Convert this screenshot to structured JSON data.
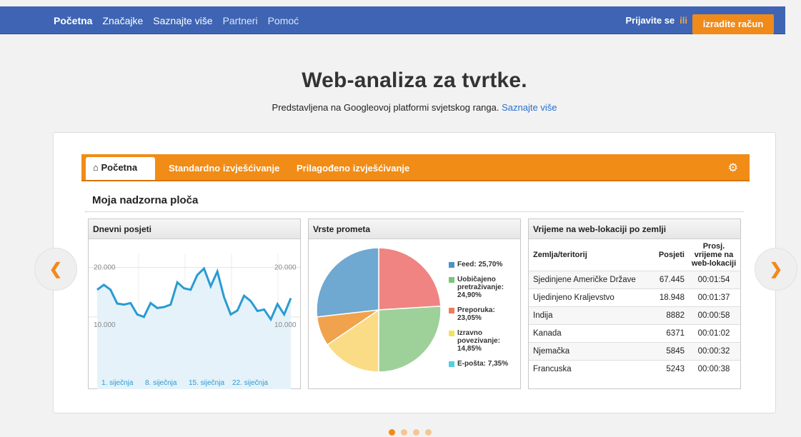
{
  "nav": {
    "items": [
      "Početna",
      "Značajke",
      "Saznajte više",
      "Partneri",
      "Pomoć"
    ],
    "signin": "Prijavite se",
    "or": "ili",
    "create": "izradite račun"
  },
  "hero": {
    "title": "Web-analiza za tvrtke.",
    "subtitle": "Predstavljena na Googleovoj platformi svjetskog ranga.",
    "link": "Saznajte više"
  },
  "dashboard": {
    "tabs": [
      "Početna",
      "Standardno izvješćivanje",
      "Prilagođeno izvješćivanje"
    ],
    "title": "Moja nadzorna ploča"
  },
  "cards": {
    "visits": {
      "title": "Dnevni posjeti"
    },
    "traffic": {
      "title": "Vrste prometa"
    },
    "time": {
      "title": "Vrijeme na web-lokaciji po zemlji"
    }
  },
  "chart_data": [
    {
      "type": "line",
      "y_ticks": [
        "20.000",
        "10.000"
      ],
      "x_ticks": [
        "1. siječnja",
        "8. siječnja",
        "15. siječnja",
        "22. siječnja"
      ],
      "values": [
        15500,
        16500,
        15500,
        12700,
        12500,
        12800,
        10500,
        10000,
        12800,
        11800,
        12000,
        12500,
        17000,
        15800,
        15500,
        18500,
        19800,
        16200,
        19200,
        14000,
        10500,
        11300,
        14300,
        13200,
        11200,
        11500,
        9500,
        12600,
        10500,
        13800
      ]
    },
    {
      "type": "pie",
      "slices": [
        {
          "label": "Feed: 25,70%",
          "value": 25.7,
          "color": "#4b93c6"
        },
        {
          "label": "Uobičajeno pretraživanje: 24,90%",
          "value": 24.9,
          "color": "#79c676"
        },
        {
          "label": "Preporuka: 23,05%",
          "value": 23.05,
          "color": "#ef7b5b"
        },
        {
          "label": "Izravno povezivanje: 14,85%",
          "value": 14.85,
          "color": "#f2e35c"
        },
        {
          "label": "E-pošta: 7,35%",
          "value": 7.35,
          "color": "#54cde1"
        }
      ]
    }
  ],
  "table": {
    "headers": [
      "Zemlja/teritorij",
      "Posjeti",
      "Prosj. vrijeme na web-lokaciji"
    ],
    "rows": [
      [
        "Sjedinjene Američke Države",
        "67.445",
        "00:01:54"
      ],
      [
        "Ujedinjeno Kraljevstvo",
        "18.948",
        "00:01:37"
      ],
      [
        "Indija",
        "8882",
        "00:00:58"
      ],
      [
        "Kanada",
        "6371",
        "00:01:02"
      ],
      [
        "Njemačka",
        "5845",
        "00:00:32"
      ],
      [
        "Francuska",
        "5243",
        "00:00:38"
      ]
    ]
  }
}
